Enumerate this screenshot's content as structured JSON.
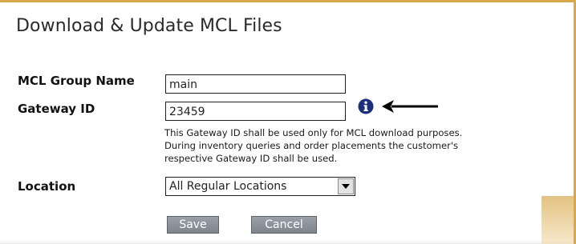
{
  "form": {
    "title": "Download & Update MCL Files",
    "group_name": {
      "label": "MCL Group Name",
      "value": "main"
    },
    "gateway_id": {
      "label": "Gateway ID",
      "value": "23459",
      "info_icon": "info-circle-icon",
      "arrow_icon": "left-arrow-icon",
      "note_lines": [
        "This Gateway ID shall be used only for MCL download purposes.",
        "During inventory queries and order placements the customer's",
        "respective Gateway ID shall be used."
      ]
    },
    "location": {
      "label": "Location",
      "selected": "All Regular Locations",
      "dropdown_icon": "chevron-down-icon"
    },
    "buttons": {
      "save_label": "Save",
      "cancel_label": "Cancel"
    }
  },
  "colors": {
    "border_accent": "#d7a84d",
    "info_icon": "#1c2f7a",
    "button_bg": "#878d94"
  }
}
